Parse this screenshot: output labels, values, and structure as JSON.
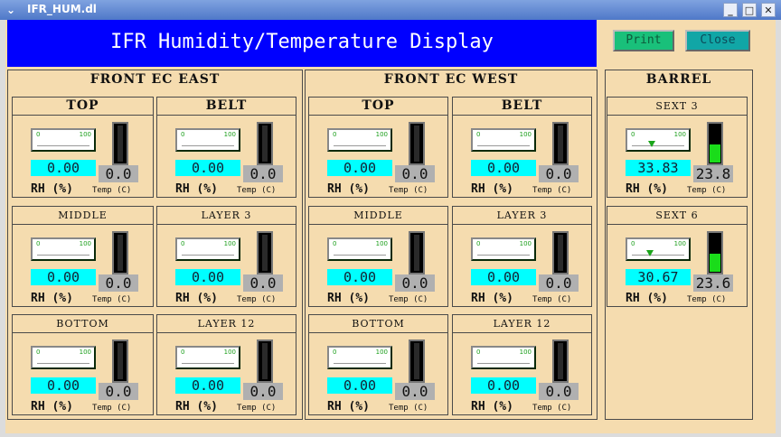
{
  "window": {
    "title": "IFR_HUM.dl",
    "minimize": "_",
    "maximize": "□",
    "close": "✕"
  },
  "header": {
    "title": "IFR Humidity/Temperature Display"
  },
  "buttons": {
    "print": "Print",
    "close": "Close"
  },
  "labels": {
    "rh": "RH (%)",
    "temp": "Temp (C)",
    "gauge_min": "0",
    "gauge_max": "100"
  },
  "regions": [
    {
      "title": "FRONT EC EAST",
      "panels": [
        {
          "name": "TOP",
          "rh": "0.00",
          "temp": "0.0",
          "rh_fraction": 0,
          "temp_fraction": 0
        },
        {
          "name": "BELT",
          "rh": "0.00",
          "temp": "0.0",
          "rh_fraction": 0,
          "temp_fraction": 0
        },
        {
          "name": "MIDDLE",
          "rh": "0.00",
          "temp": "0.0",
          "rh_fraction": 0,
          "temp_fraction": 0
        },
        {
          "name": "LAYER 3",
          "rh": "0.00",
          "temp": "0.0",
          "rh_fraction": 0,
          "temp_fraction": 0
        },
        {
          "name": "BOTTOM",
          "rh": "0.00",
          "temp": "0.0",
          "rh_fraction": 0,
          "temp_fraction": 0
        },
        {
          "name": "LAYER 12",
          "rh": "0.00",
          "temp": "0.0",
          "rh_fraction": 0,
          "temp_fraction": 0
        }
      ]
    },
    {
      "title": "FRONT EC WEST",
      "panels": [
        {
          "name": "TOP",
          "rh": "0.00",
          "temp": "0.0",
          "rh_fraction": 0,
          "temp_fraction": 0
        },
        {
          "name": "BELT",
          "rh": "0.00",
          "temp": "0.0",
          "rh_fraction": 0,
          "temp_fraction": 0
        },
        {
          "name": "MIDDLE",
          "rh": "0.00",
          "temp": "0.0",
          "rh_fraction": 0,
          "temp_fraction": 0
        },
        {
          "name": "LAYER 3",
          "rh": "0.00",
          "temp": "0.0",
          "rh_fraction": 0,
          "temp_fraction": 0
        },
        {
          "name": "BOTTOM",
          "rh": "0.00",
          "temp": "0.0",
          "rh_fraction": 0,
          "temp_fraction": 0
        },
        {
          "name": "LAYER 12",
          "rh": "0.00",
          "temp": "0.0",
          "rh_fraction": 0,
          "temp_fraction": 0
        }
      ]
    },
    {
      "title": "BARREL",
      "panels": [
        {
          "name": "SEXT 3",
          "rh": "33.83",
          "temp": "23.8",
          "rh_fraction": 0.3383,
          "temp_fraction": 0.45
        },
        {
          "name": "SEXT 6",
          "rh": "30.67",
          "temp": "23.6",
          "rh_fraction": 0.3067,
          "temp_fraction": 0.45
        }
      ]
    }
  ],
  "colors": {
    "header_bg": "#0000ff",
    "rh_value_bg": "#00ffff",
    "temp_value_bg": "#b0b0b0",
    "bar_fill": "#1adc1a",
    "print_button": "#19c07a",
    "close_button": "#11a6a6",
    "background": "#f5dcaf"
  }
}
